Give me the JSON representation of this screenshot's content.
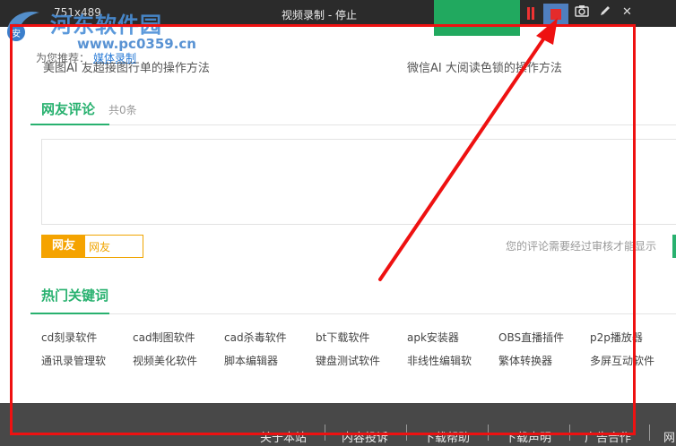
{
  "recorder": {
    "size_label": "751x489",
    "title": "视频录制 - 停止",
    "icons": [
      "pause-icon",
      "stop-icon",
      "camera-icon",
      "pen-icon",
      "close-icon"
    ],
    "close_glyph": "✕",
    "stop_color": "#e42b2b"
  },
  "watermark": {
    "name": "河东软件园",
    "url": "www.pc0359.cn",
    "logo_glyph": "安"
  },
  "recommend": {
    "label": "为您推荐：",
    "link": "媒体录制",
    "left_partial": "美图AI 友超接图行单的操作方法",
    "right_partial": "微信AI 大阅读色锁的操作方法"
  },
  "comments": {
    "title": "网友评论",
    "count": "共0条",
    "nick_label": "网友",
    "nick_value": "网友",
    "notice": "您的评论需要经过审核才能显示"
  },
  "keywords": {
    "title": "热门关键词",
    "rows": [
      [
        "cd刻录软件",
        "cad制图软件",
        "cad杀毒软件",
        "bt下载软件",
        "apk安装器",
        "OBS直播插件",
        "p2p播放器"
      ],
      [
        "通讯录管理软",
        "视频美化软件",
        "脚本编辑器",
        "键盘测试软件",
        "非线性编辑软",
        "繁体转换器",
        "多屏互动软件"
      ]
    ]
  },
  "footer": {
    "links": [
      "关于本站",
      "内容投诉",
      "下载帮助",
      "下载声明",
      "广告合作",
      "网"
    ]
  },
  "colors": {
    "accent_green": "#28b16f",
    "annotation_red": "#ee1111",
    "nick_orange": "#f5a300",
    "footer_bg": "#484848"
  }
}
